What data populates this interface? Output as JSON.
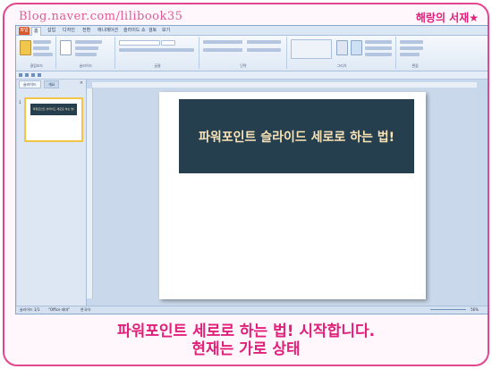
{
  "blog": {
    "url": "Blog.naver.com/lilibook35",
    "name": "해랑의 서재★"
  },
  "app": {
    "ribbon_tabs": [
      "홈",
      "삽입",
      "디자인",
      "전환",
      "애니메이션",
      "슬라이드 쇼",
      "검토",
      "보기"
    ],
    "file_tab": "파일",
    "ribbon_groups": [
      "클립보드",
      "슬라이드",
      "글꼴",
      "단락",
      "그리기",
      "편집"
    ],
    "panel_tabs": [
      "슬라이드",
      "개요"
    ],
    "slide_number": "1",
    "slide_title": "파워포인트 슬라이드 세로로 하는 법!",
    "status": {
      "slide_info": "슬라이드 1/1",
      "theme": "\"Office 테마\"",
      "language": "한국어",
      "zoom": "56%"
    },
    "colors": {
      "title_bg": "#263f4f",
      "title_text": "#f8e3b6"
    }
  },
  "caption": {
    "line1": "파워포인트 세로로 하는 법! 시작합니다.",
    "line2": "현재는 가로 상태"
  }
}
